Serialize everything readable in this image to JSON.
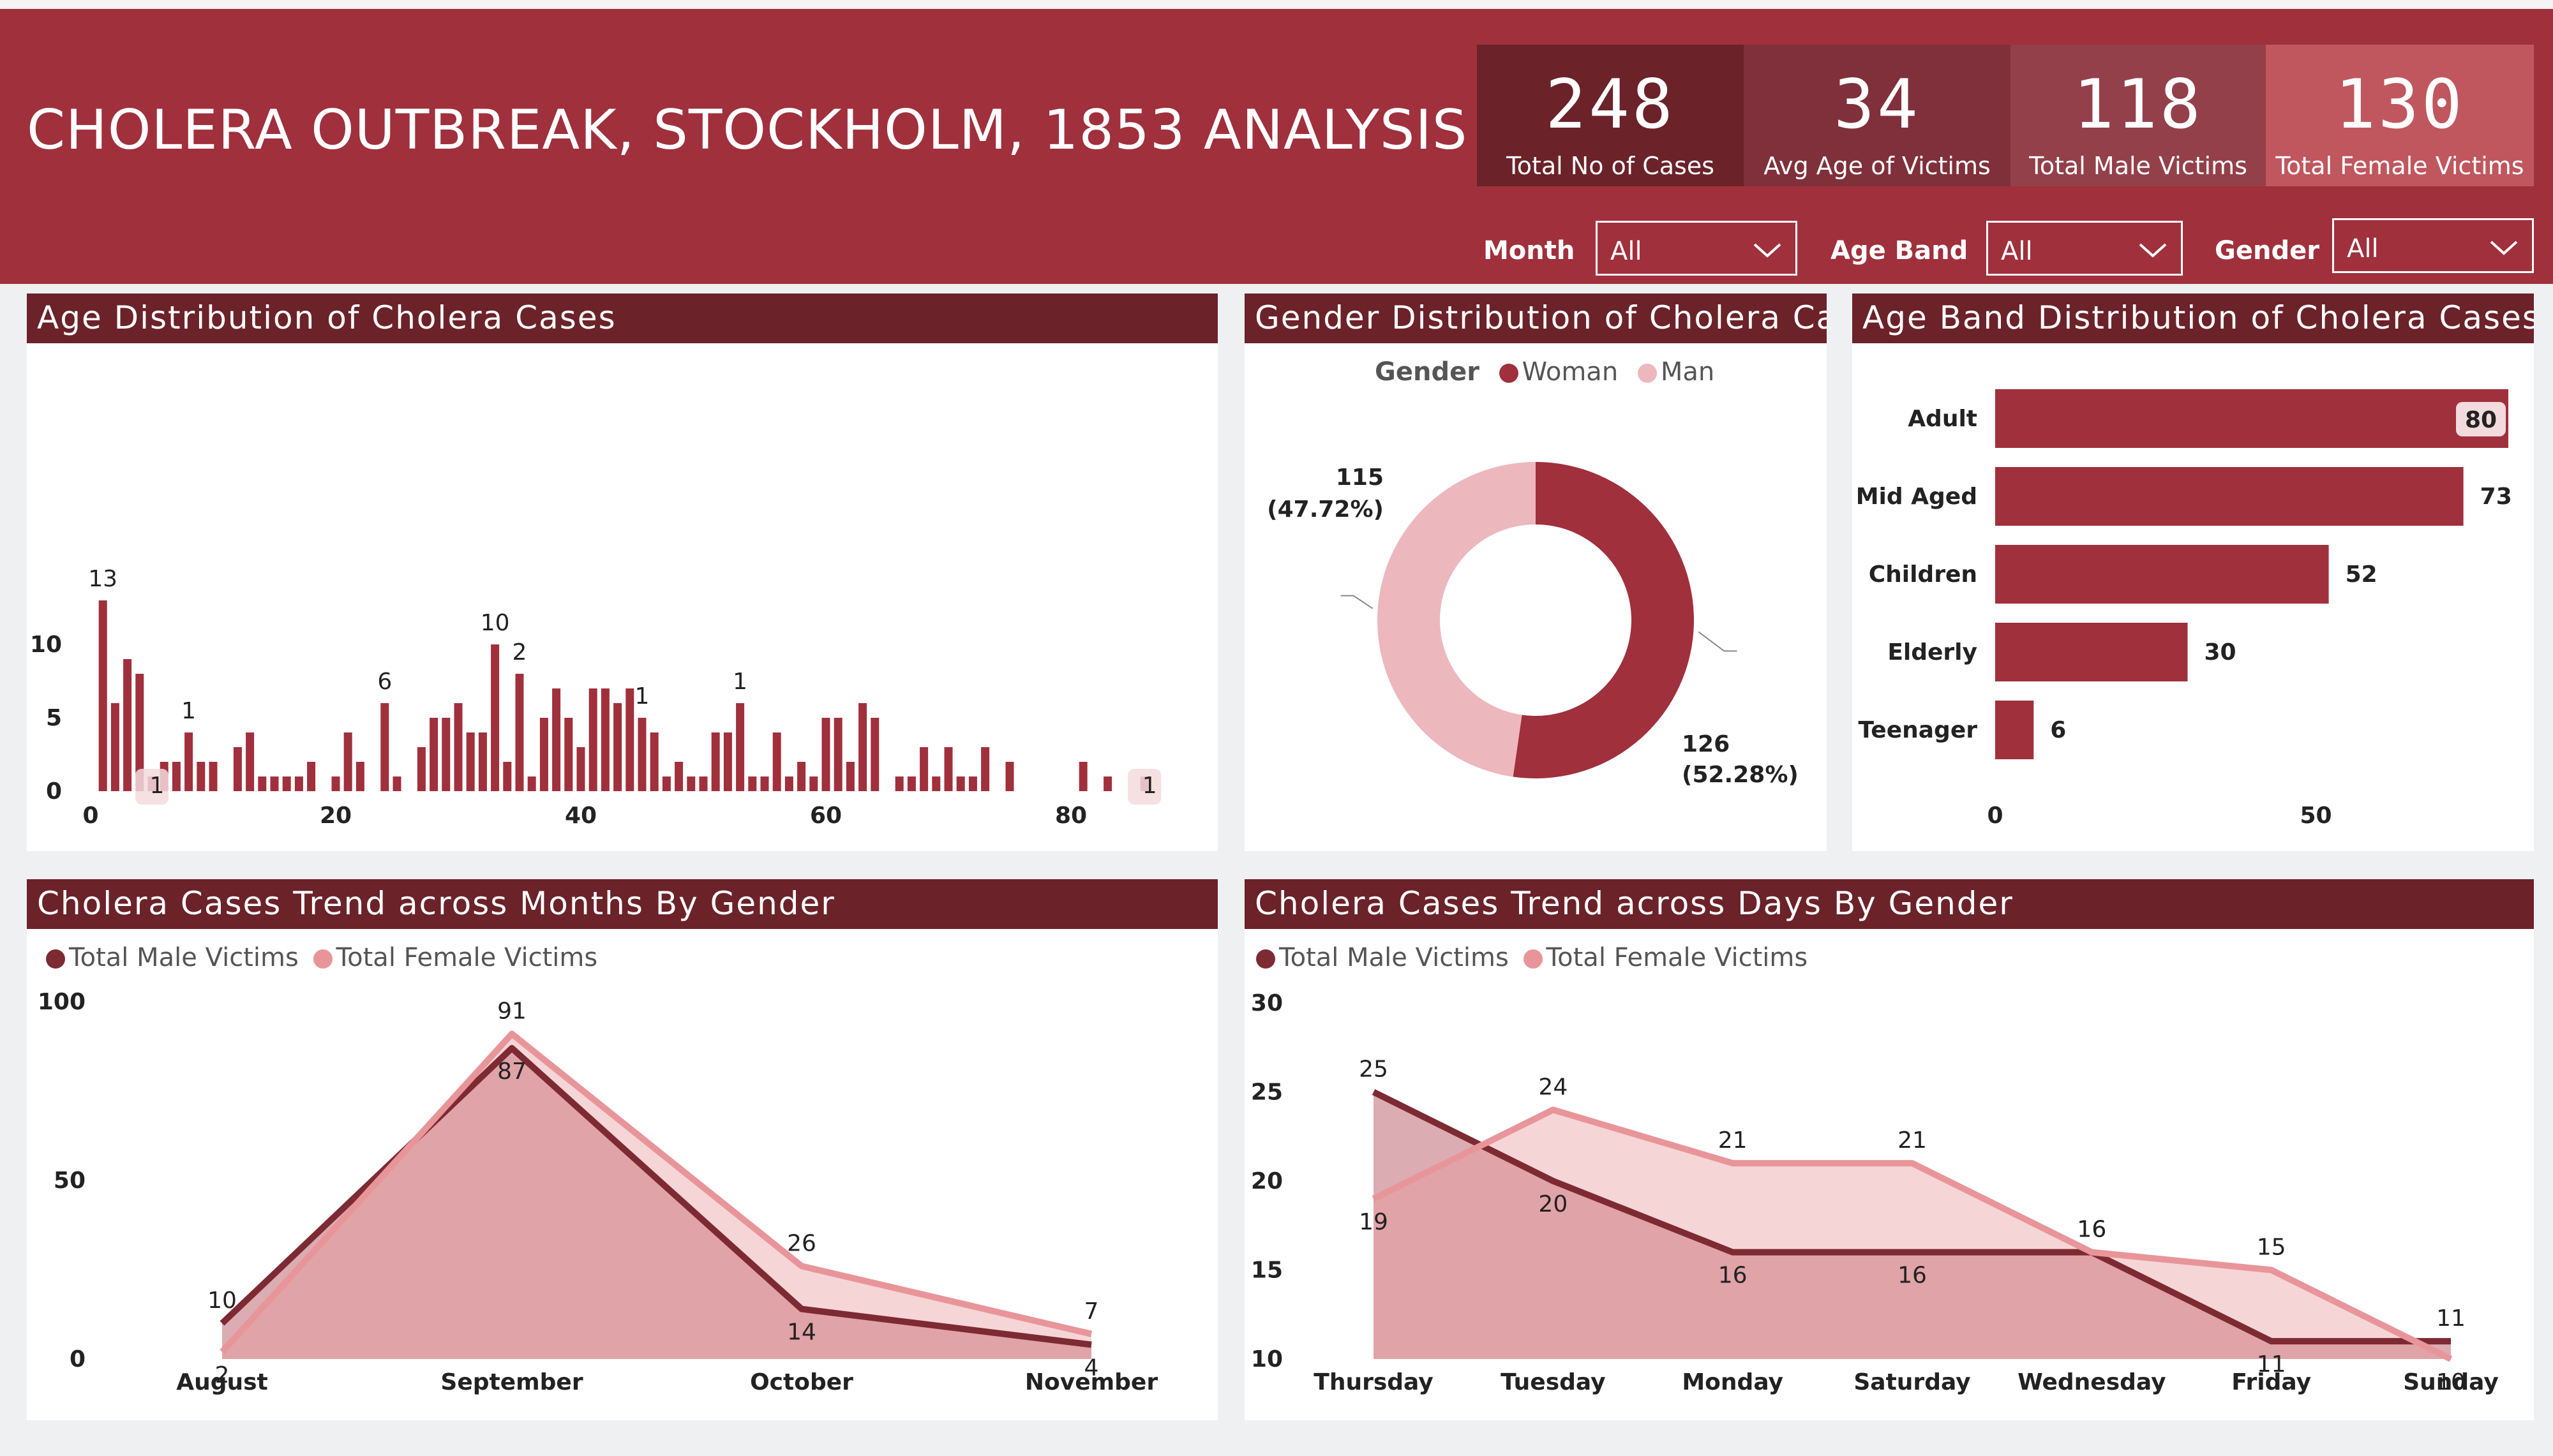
{
  "header": {
    "title": "CHOLERA OUTBREAK, STOCKHOLM, 1853 ANALYSIS",
    "kpis": [
      {
        "value": "248",
        "label": "Total No of Cases",
        "color": "#6b2229"
      },
      {
        "value": "34",
        "label": "Avg Age of Victims",
        "color": "#80303a"
      },
      {
        "value": "118",
        "label": "Total Male Victims",
        "color": "#94404a"
      },
      {
        "value": "130",
        "label": "Total Female Victims",
        "color": "#c0575e"
      }
    ],
    "filters": [
      {
        "label": "Month",
        "value": "All"
      },
      {
        "label": "Age Band",
        "value": "All"
      },
      {
        "label": "Gender",
        "value": "All"
      }
    ]
  },
  "colors": {
    "dark": "#a0303c",
    "maroon": "#6b2229",
    "male": "#7d2a33",
    "female": "#e8959a",
    "pink": "#ecb8bd"
  },
  "chart_data": [
    {
      "type": "bar",
      "title": "Age Distribution of Cholera Cases",
      "x": [
        1,
        2,
        3,
        4,
        5,
        6,
        7,
        8,
        9,
        10,
        12,
        13,
        14,
        15,
        16,
        17,
        18,
        20,
        21,
        22,
        24,
        25,
        27,
        28,
        29,
        30,
        31,
        32,
        33,
        34,
        35,
        36,
        37,
        38,
        39,
        40,
        41,
        42,
        43,
        44,
        45,
        46,
        47,
        48,
        49,
        50,
        51,
        52,
        53,
        54,
        55,
        56,
        57,
        58,
        59,
        60,
        61,
        62,
        63,
        64,
        66,
        67,
        68,
        69,
        70,
        71,
        72,
        73,
        75,
        81,
        83,
        86
      ],
      "values": [
        13,
        6,
        9,
        8,
        1,
        2,
        2,
        4,
        2,
        2,
        3,
        4,
        1,
        1,
        1,
        1,
        2,
        1,
        4,
        2,
        6,
        1,
        3,
        5,
        5,
        6,
        4,
        4,
        10,
        2,
        8,
        1,
        5,
        7,
        5,
        3,
        7,
        7,
        6,
        7,
        5,
        4,
        1,
        2,
        1,
        1,
        4,
        4,
        6,
        1,
        1,
        4,
        1,
        2,
        1,
        5,
        5,
        2,
        6,
        5,
        1,
        1,
        3,
        1,
        3,
        1,
        1,
        3,
        2,
        2,
        1,
        1
      ],
      "data_labels": [
        {
          "x": 1,
          "text": "13"
        },
        {
          "x": 24,
          "text": "6"
        },
        {
          "x": 33,
          "text": "10"
        },
        {
          "x": 5,
          "text": "1"
        },
        {
          "x": 8,
          "text": "1"
        },
        {
          "x": 35,
          "text": "2"
        },
        {
          "x": 45,
          "text": "1"
        },
        {
          "x": 53,
          "text": "1"
        },
        {
          "x": 86,
          "text": "1"
        }
      ],
      "xlim": [
        0,
        88
      ],
      "ylim": [
        0,
        13
      ],
      "xticks": [
        0,
        20,
        40,
        60,
        80
      ],
      "yticks": [
        0,
        5,
        10
      ]
    },
    {
      "type": "pie",
      "title": "Gender Distribution of Cholera Cases",
      "legend_title": "Gender",
      "slices": [
        {
          "name": "Woman",
          "value": 126,
          "label": "126",
          "pct": "(52.28%)"
        },
        {
          "name": "Man",
          "value": 115,
          "label": "115",
          "pct": "(47.72%)"
        }
      ]
    },
    {
      "type": "bar",
      "orientation": "horizontal",
      "title": "Age Band Distribution of Cholera Cases",
      "categories": [
        "Adult",
        "Mid Aged",
        "Children",
        "Elderly",
        "Teenager"
      ],
      "values": [
        80,
        73,
        52,
        30,
        6
      ],
      "xlim": [
        0,
        80
      ],
      "xticks": [
        0,
        50
      ]
    },
    {
      "type": "area",
      "title": "Cholera Cases Trend across Months By Gender",
      "categories": [
        "August",
        "September",
        "October",
        "November"
      ],
      "series": [
        {
          "name": "Total Male Victims",
          "values": [
            10,
            87,
            14,
            4
          ]
        },
        {
          "name": "Total Female Victims",
          "values": [
            2,
            91,
            26,
            7
          ]
        }
      ],
      "ylim": [
        0,
        100
      ],
      "yticks": [
        0,
        50,
        100
      ]
    },
    {
      "type": "area",
      "title": "Cholera Cases Trend across Days By Gender",
      "categories": [
        "Thursday",
        "Tuesday",
        "Monday",
        "Saturday",
        "Wednesday",
        "Friday",
        "Sunday"
      ],
      "series": [
        {
          "name": "Total Male Victims",
          "values": [
            25,
            20,
            16,
            16,
            16,
            11,
            11
          ]
        },
        {
          "name": "Total Female Victims",
          "values": [
            19,
            24,
            21,
            21,
            16,
            15,
            10
          ]
        }
      ],
      "ylim": [
        10,
        30
      ],
      "yticks": [
        10,
        15,
        20,
        25,
        30
      ]
    }
  ]
}
